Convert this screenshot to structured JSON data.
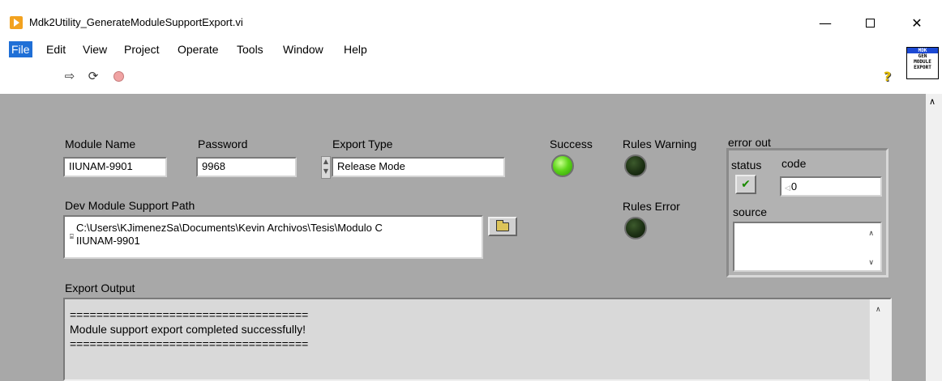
{
  "window": {
    "title": "Mdk2Utility_GenerateModuleSupportExport.vi",
    "min_symbol": "—",
    "close_symbol": "✕"
  },
  "menu": {
    "items": [
      "File",
      "Edit",
      "View",
      "Project",
      "Operate",
      "Tools",
      "Window",
      "Help"
    ],
    "active": "File"
  },
  "toolbar": {
    "run_icon": "⇨",
    "run_continuous_icon": "⟳",
    "help_icon": "?"
  },
  "vi_icon": {
    "line1": "MDK",
    "line2": "GEN",
    "line3": "MODULE",
    "line4": "EXPORT"
  },
  "controls": {
    "module_name": {
      "label": "Module Name",
      "value": "IIUNAM-9901"
    },
    "password": {
      "label": "Password",
      "value": "9968"
    },
    "export_type": {
      "label": "Export Type",
      "value": "Release Mode"
    },
    "dev_path": {
      "label": "Dev Module Support Path",
      "line1": "C:\\Users\\KJimenezSa\\Documents\\Kevin Archivos\\Tesis\\Modulo C",
      "line2": "IIUNAM-9901"
    }
  },
  "indicators": {
    "success": {
      "label": "Success",
      "state": "on"
    },
    "rules_warning": {
      "label": "Rules Warning",
      "state": "off"
    },
    "rules_error": {
      "label": "Rules Error",
      "state": "off"
    }
  },
  "error_out": {
    "label": "error out",
    "status_label": "status",
    "code_label": "code",
    "code_value": "0",
    "source_label": "source",
    "status_mark": "✔"
  },
  "export_output": {
    "label": "Export Output",
    "line1": "====================================",
    "line2": "Module support export completed successfully!",
    "line3": "===================================="
  },
  "colors": {
    "panel": "#a8a8a8",
    "led_on": "#5fd61b",
    "led_off": "#1d3114",
    "menu_active": "#1f6fd6"
  }
}
